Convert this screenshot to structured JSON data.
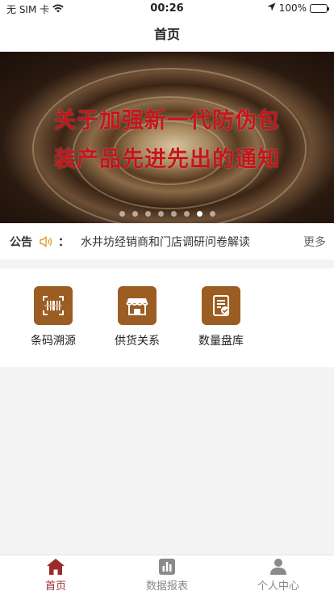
{
  "status_bar": {
    "carrier": "无 SIM 卡",
    "time": "00:26",
    "battery": "100%"
  },
  "nav": {
    "title": "首页"
  },
  "banner": {
    "line1": "关于加强新一代防伪包",
    "line2": "装产品先进先出的通知",
    "slide_count": 8,
    "active_slide": 6
  },
  "notice": {
    "label": "公告",
    "colon": "：",
    "text": "水井坊经销商和门店调研问卷解读",
    "more": "更多"
  },
  "features": [
    {
      "label": "条码溯源",
      "icon": "barcode-scan-icon"
    },
    {
      "label": "供货关系",
      "icon": "store-icon"
    },
    {
      "label": "数量盘库",
      "icon": "inventory-check-icon"
    }
  ],
  "tabs": [
    {
      "label": "首页",
      "icon": "home-icon",
      "active": true
    },
    {
      "label": "数据报表",
      "icon": "bar-chart-icon",
      "active": false
    },
    {
      "label": "个人中心",
      "icon": "user-icon",
      "active": false
    }
  ],
  "colors": {
    "accent": "#9d2b2b",
    "icon_bg": "#9b5d22",
    "banner_text": "#c8141b"
  }
}
